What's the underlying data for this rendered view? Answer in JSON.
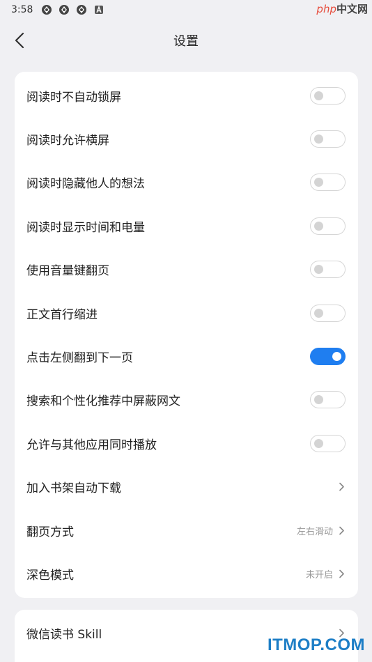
{
  "status_bar": {
    "time": "3:58",
    "icons": [
      "sync-icon",
      "sync-icon",
      "sync-icon",
      "notification-a-icon"
    ]
  },
  "watermark_top": {
    "php": "php",
    "cn": "中文网"
  },
  "header": {
    "title": "设置",
    "back_icon": "back-arrow-icon"
  },
  "settings": [
    {
      "label": "阅读时不自动锁屏",
      "type": "toggle",
      "on": false
    },
    {
      "label": "阅读时允许横屏",
      "type": "toggle",
      "on": false
    },
    {
      "label": "阅读时隐藏他人的想法",
      "type": "toggle",
      "on": false
    },
    {
      "label": "阅读时显示时间和电量",
      "type": "toggle",
      "on": false
    },
    {
      "label": "使用音量键翻页",
      "type": "toggle",
      "on": false
    },
    {
      "label": "正文首行缩进",
      "type": "toggle",
      "on": false
    },
    {
      "label": "点击左侧翻到下一页",
      "type": "toggle",
      "on": true
    },
    {
      "label": "搜索和个性化推荐中屏蔽网文",
      "type": "toggle",
      "on": false
    },
    {
      "label": "允许与其他应用同时播放",
      "type": "toggle",
      "on": false
    },
    {
      "label": "加入书架自动下载",
      "type": "link",
      "value": ""
    },
    {
      "label": "翻页方式",
      "type": "link",
      "value": "左右滑动"
    },
    {
      "label": "深色模式",
      "type": "link",
      "value": "未开启"
    }
  ],
  "settings_2": [
    {
      "label": "微信读书 Skill",
      "type": "link",
      "value": ""
    }
  ],
  "watermark_bottom": "ITMOP.COM",
  "colors": {
    "accent": "#1f7ef0",
    "background": "#f0f0f3",
    "card": "#ffffff"
  }
}
